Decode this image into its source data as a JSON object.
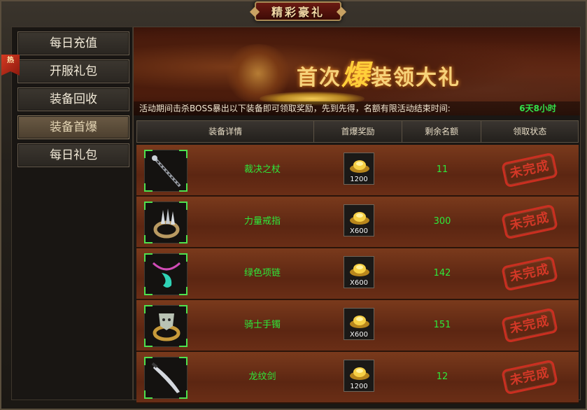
{
  "window": {
    "title": "精彩豪礼"
  },
  "sidebar": {
    "items": [
      {
        "label": "每日充值"
      },
      {
        "label": "开服礼包"
      },
      {
        "label": "装备回收"
      },
      {
        "label": "装备首爆",
        "active": true
      },
      {
        "label": "每日礼包"
      }
    ],
    "ribbon_label": "热"
  },
  "banner": {
    "title_prefix": "首次",
    "title_highlight": "爆",
    "title_suffix": "装领大礼",
    "info": "活动期间击杀BOSS暴出以下装备即可领取奖励，先到先得，名额有限活动结束时间:",
    "time_left": "6天8小时"
  },
  "table": {
    "headers": [
      "装备详情",
      "首爆奖励",
      "剩余名额",
      "领取状态"
    ],
    "rows": [
      {
        "item": "裁决之杖",
        "item_icon": "staff-icon",
        "reward_qty": "1200",
        "remaining": "11",
        "status": "未完成"
      },
      {
        "item": "力量戒指",
        "item_icon": "spiked-ring-icon",
        "reward_qty": "X600",
        "remaining": "300",
        "status": "未完成"
      },
      {
        "item": "绿色项链",
        "item_icon": "green-necklace-icon",
        "reward_qty": "X600",
        "remaining": "142",
        "status": "未完成"
      },
      {
        "item": "骑士手镯",
        "item_icon": "knight-bracelet-icon",
        "reward_qty": "X600",
        "remaining": "151",
        "status": "未完成"
      },
      {
        "item": "龙纹剑",
        "item_icon": "dragon-sword-icon",
        "reward_qty": "1200",
        "remaining": "12",
        "status": "未完成"
      }
    ]
  },
  "colors": {
    "accent_green": "#2ee83a",
    "stamp_red": "#d62f22",
    "gold": "#f6d27a"
  }
}
